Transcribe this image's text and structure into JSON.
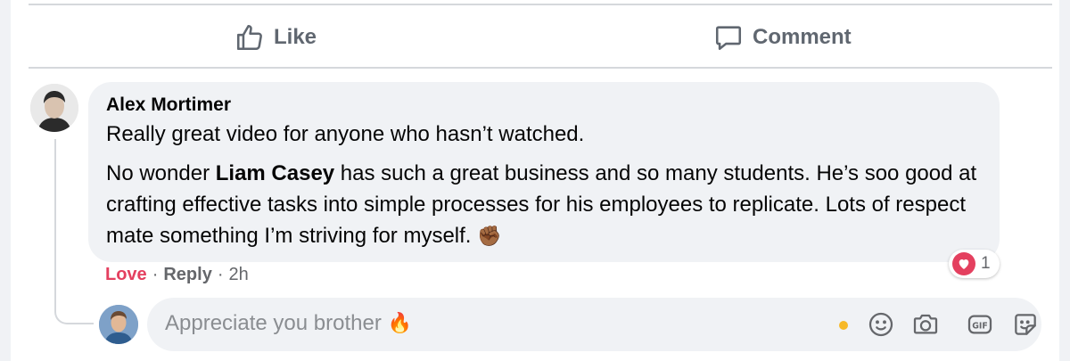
{
  "actions": {
    "like_label": "Like",
    "comment_label": "Comment"
  },
  "comment": {
    "author": "Alex Mortimer",
    "line1": "Really great video for anyone who hasn’t watched.",
    "para_before": "No wonder ",
    "mention": "Liam Casey",
    "para_after": " has such a great business and so many students. He’s soo good at crafting effective tasks into simple processes for his employees to replicate. Lots of respect mate something I’m striving for myself. ",
    "emoji": "✊🏾",
    "reaction_icon": "heart-icon",
    "reaction_count": "1",
    "love_label": "Love",
    "reply_label": "Reply",
    "separator": "·",
    "time": "2h"
  },
  "composer": {
    "text": "Appreciate you brother ",
    "emoji": "🔥",
    "icons": [
      "smiley-icon",
      "camera-icon",
      "gif-icon",
      "sticker-icon"
    ]
  },
  "colors": {
    "love": "#e4405f",
    "muted": "#65676b",
    "bubble": "#f0f2f5",
    "typing_dot": "#f7b928"
  }
}
